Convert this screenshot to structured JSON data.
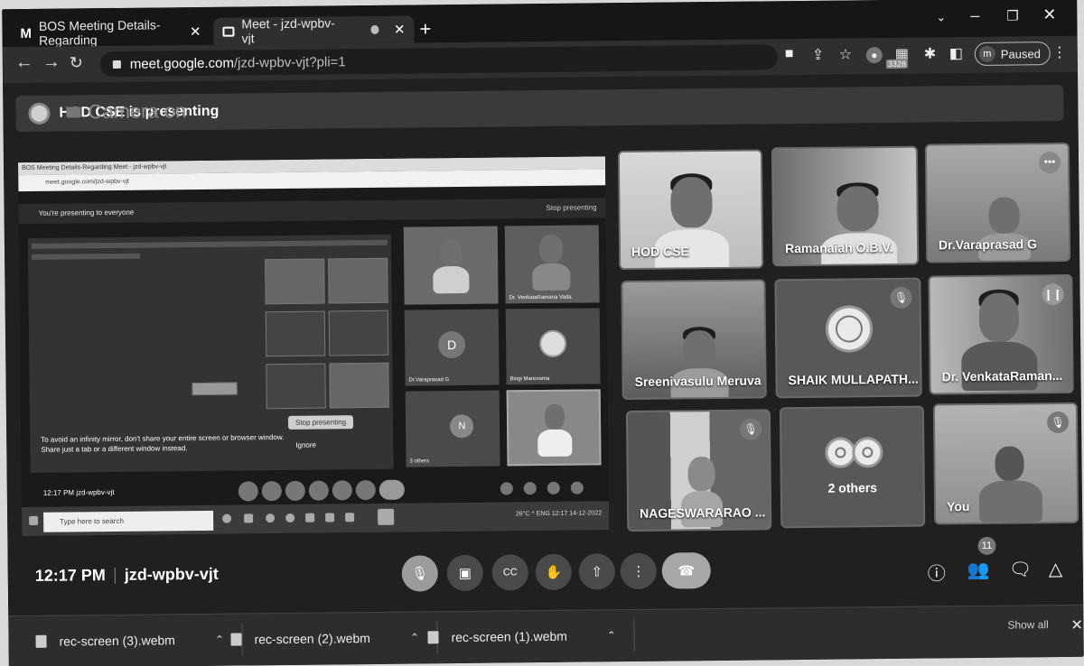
{
  "browser": {
    "tabs": [
      {
        "label": "BOS Meeting Details-Regarding",
        "close": "✕"
      },
      {
        "label": "Meet - jzd-wpbv-vjt",
        "close": "✕"
      }
    ],
    "new_tab": "+",
    "url_host": "meet.google.com",
    "url_path": "/jzd-wpbv-vjt?pli=1",
    "extension_badge": "3328",
    "profile_initial": "m",
    "profile_status": "Paused"
  },
  "meet": {
    "camera_overlay": "Camera on",
    "presenting_banner": "HOD CSE is presenting",
    "presented_screen": {
      "tab_text": "BOS Meeting Details-Regarding   Meet - jzd-wpbv-vjt",
      "address": "meet.google.com/jzd-wpbv-vjt",
      "notice": "You're presenting to everyone",
      "stop_link": "Stop presenting",
      "warning": "To avoid an infinity mirror, don't share your entire screen or browser window. Share just a tab or a different window instead.",
      "stop_button": "Stop presenting",
      "ignore": "Ignore",
      "time_code": "12:17 PM   jzd-wpbv-vjt",
      "search_placeholder": "Type here to search",
      "tray": "26°C  ^  ENG  12:17 14-12-2022",
      "mini_tiles": [
        {
          "label": ""
        },
        {
          "label": "Dr. VenkataRamana Vada"
        },
        {
          "label": "Dr.Varaprasad G",
          "initial": "D"
        },
        {
          "label": "Bingi Manorama"
        },
        {
          "label": "3 others",
          "initial": "N"
        },
        {
          "label": ""
        }
      ]
    },
    "participants": [
      {
        "name": "HOD CSE",
        "muted": false
      },
      {
        "name": "Ramanaiah O.B.V.",
        "muted": false
      },
      {
        "name": "Dr.Varaprasad G",
        "muted": false,
        "more": "•••"
      },
      {
        "name": "Sreenivasulu Meruva",
        "muted": false
      },
      {
        "name": "SHAIK MULLAPATH...",
        "muted": true
      },
      {
        "name": "Dr. VenkataRaman...",
        "muted": false
      },
      {
        "name": "NAGESWARARAO ...",
        "muted": true
      },
      {
        "name": "2 others",
        "muted": false
      },
      {
        "name": "You",
        "muted": true
      }
    ],
    "bottom": {
      "time": "12:17 PM",
      "meeting_code": "jzd-wpbv-vjt",
      "people_count": "11"
    }
  },
  "downloads": {
    "items": [
      {
        "name": "rec-screen (3).webm"
      },
      {
        "name": "rec-screen (2).webm"
      },
      {
        "name": "rec-screen (1).webm"
      }
    ],
    "show_all": "Show all",
    "close": "✕"
  }
}
